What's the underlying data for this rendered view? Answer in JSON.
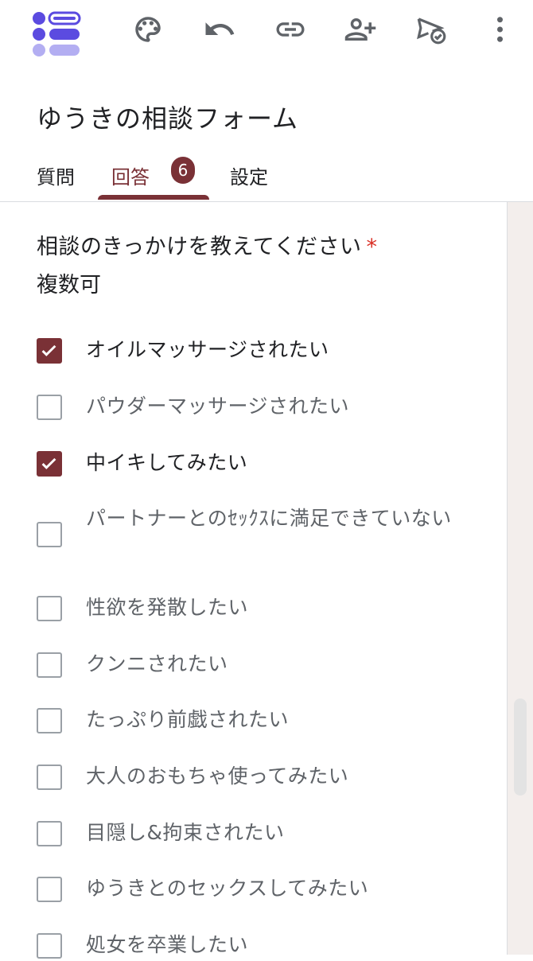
{
  "form": {
    "title": "ゆうきの相談フォーム"
  },
  "tabs": [
    {
      "label": "質問"
    },
    {
      "label": "回答",
      "badge": "6"
    },
    {
      "label": "設定"
    }
  ],
  "toolbar": {
    "icons": [
      "forms-logo-icon",
      "palette-icon",
      "undo-icon",
      "link-icon",
      "add-collaborator-icon",
      "send-icon",
      "more-vert-icon"
    ]
  },
  "question": {
    "title": "相談のきっかけを教えてください",
    "required_mark": "*",
    "description": "複数可",
    "options": [
      {
        "label": "オイルマッサージされたい",
        "checked": true
      },
      {
        "label": "パウダーマッサージされたい",
        "checked": false
      },
      {
        "label": "中イキしてみたい",
        "checked": true
      },
      {
        "label": "パートナーとのｾｯｸｽに満足できていない",
        "checked": false
      },
      {
        "label": "性欲を発散したい",
        "checked": false
      },
      {
        "label": "クンニされたい",
        "checked": false
      },
      {
        "label": "たっぷり前戯されたい",
        "checked": false
      },
      {
        "label": "大人のおもちゃ使ってみたい",
        "checked": false
      },
      {
        "label": "目隠し&拘束されたい",
        "checked": false
      },
      {
        "label": "ゆうきとのセックスしてみたい",
        "checked": false
      },
      {
        "label": "処女を卒業したい",
        "checked": false
      }
    ]
  },
  "colors": {
    "accent": "#7a3136",
    "checkbox_border": "#9aa0a6",
    "required": "#d93025",
    "logo": "#5b4be0"
  }
}
